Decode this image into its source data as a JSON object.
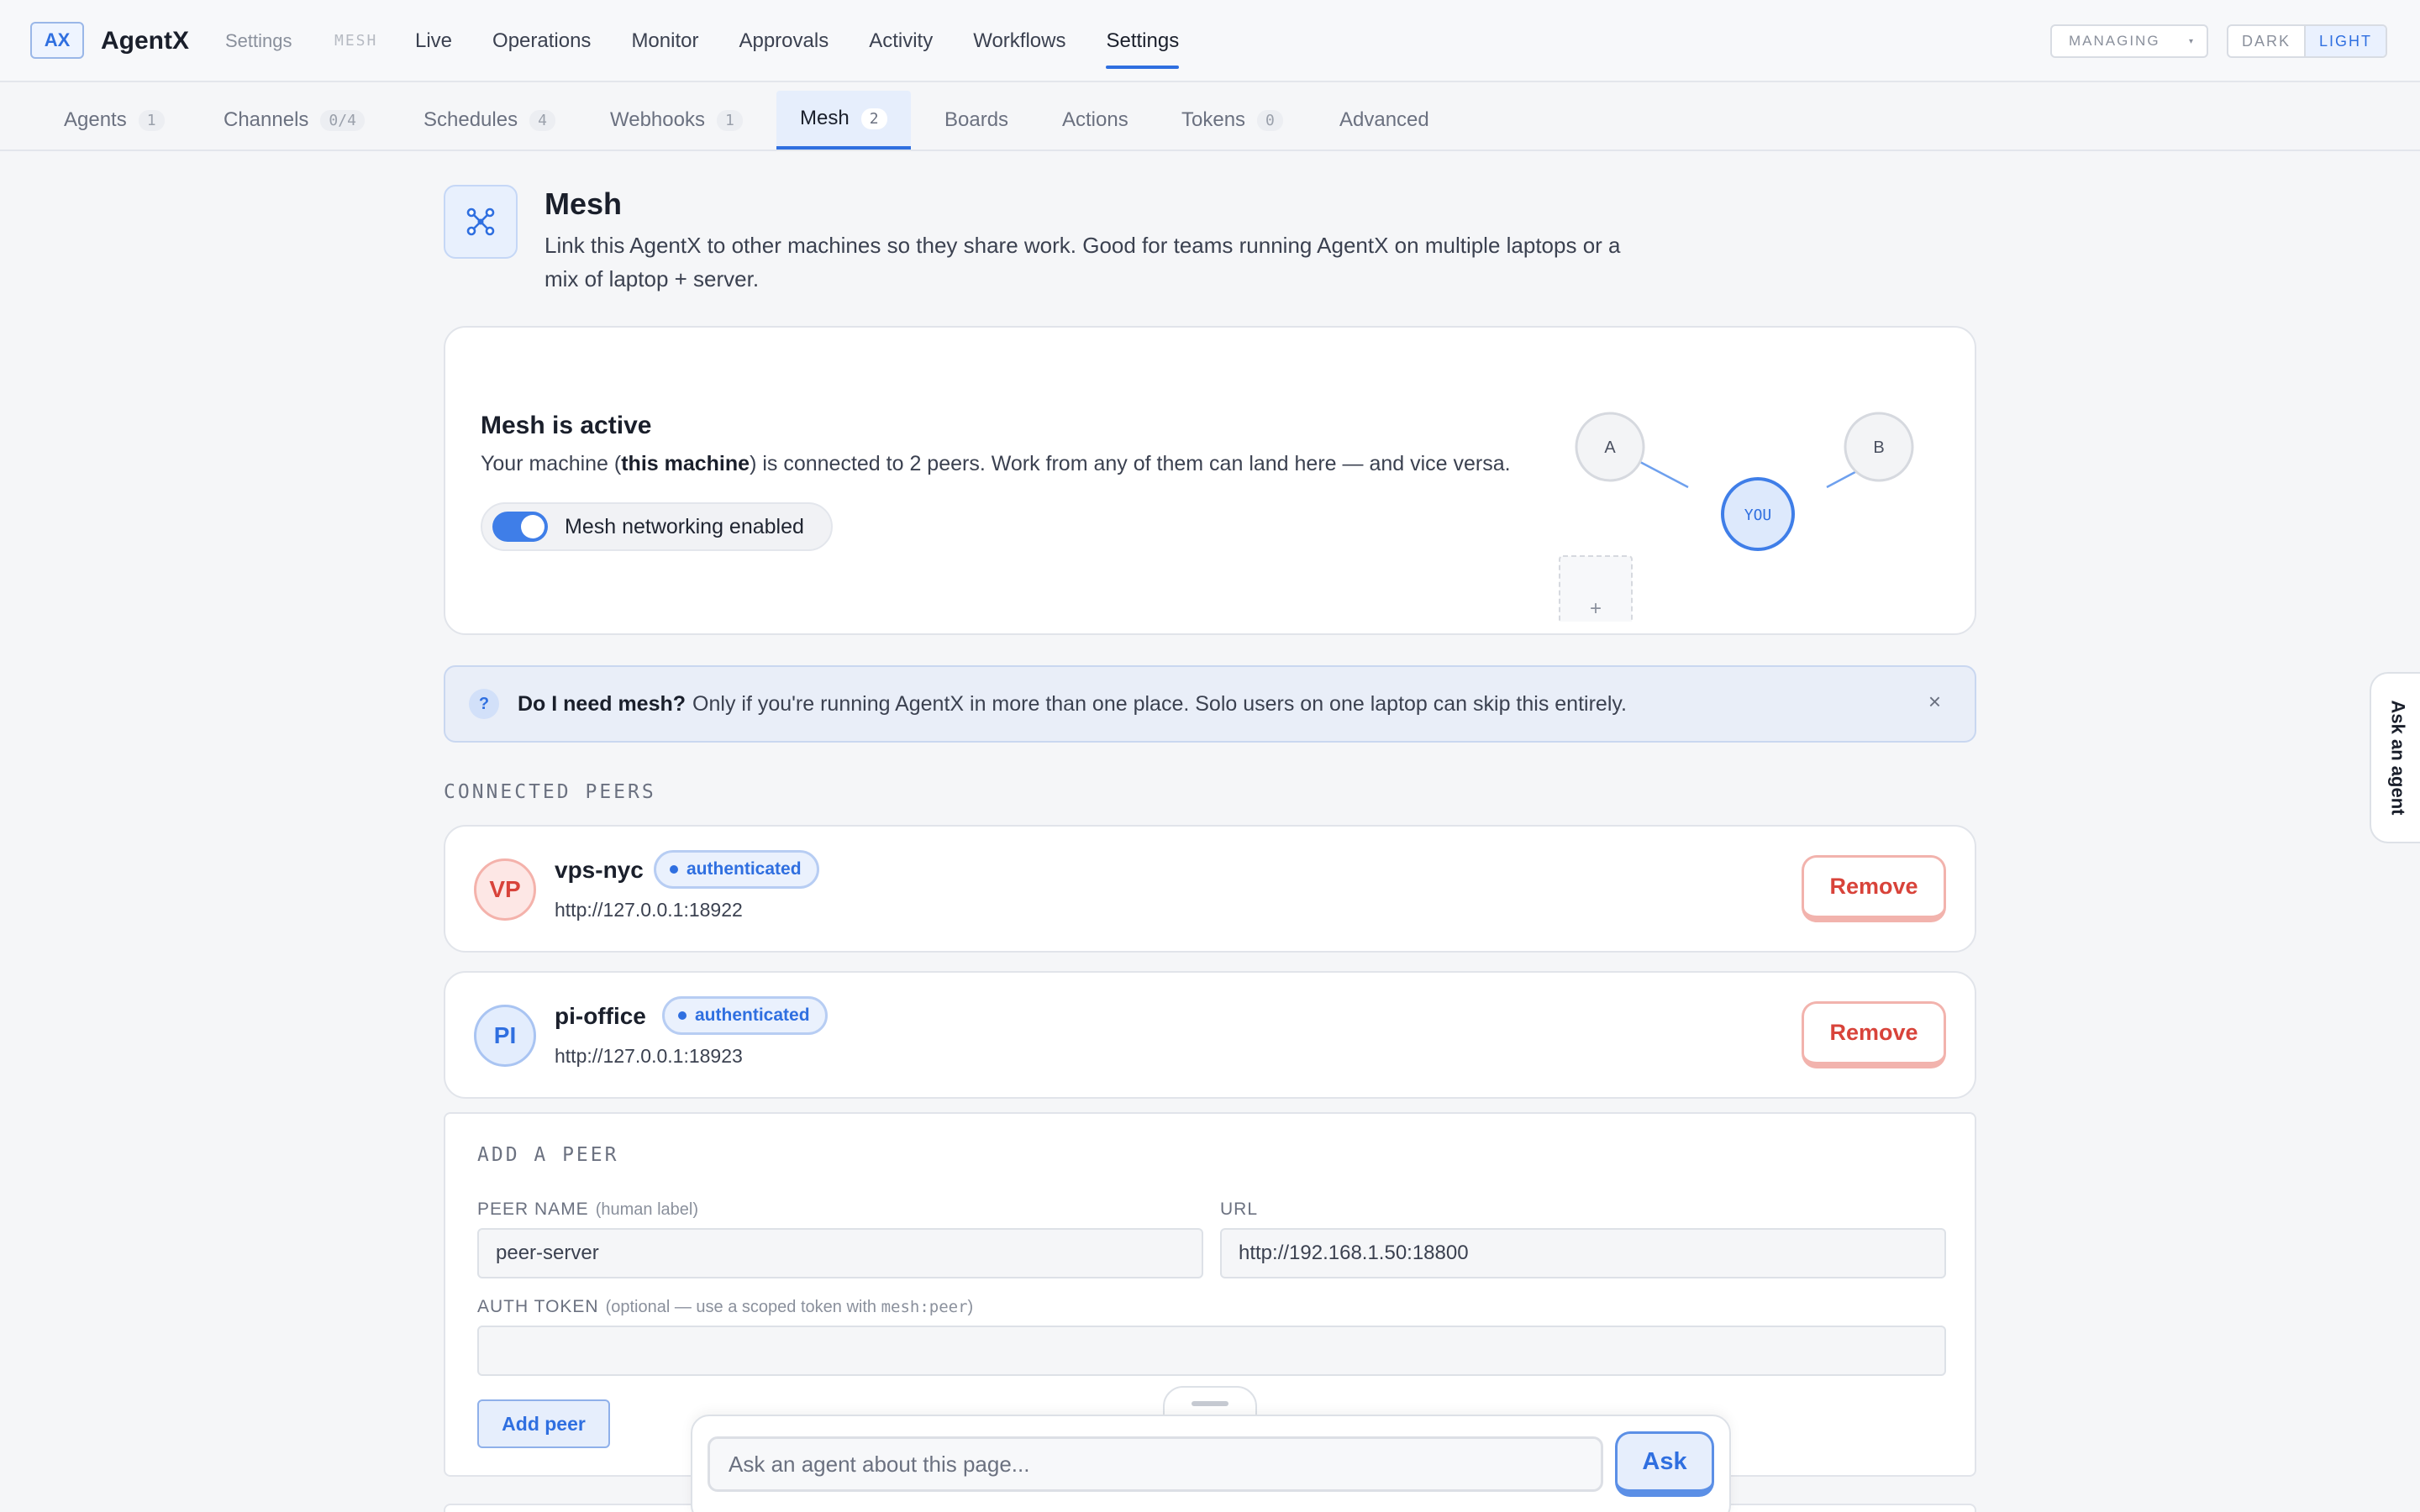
{
  "app": {
    "logo": "AX",
    "name": "AgentX",
    "breadcrumb": "Settings",
    "section_tag": "MESH"
  },
  "topnav": {
    "items": [
      {
        "label": "Live",
        "active": false
      },
      {
        "label": "Operations",
        "active": false
      },
      {
        "label": "Monitor",
        "active": false
      },
      {
        "label": "Approvals",
        "active": false
      },
      {
        "label": "Activity",
        "active": false
      },
      {
        "label": "Workflows",
        "active": false
      },
      {
        "label": "Settings",
        "active": true
      }
    ],
    "managing_label": "MANAGING",
    "theme": {
      "dark": "DARK",
      "light": "LIGHT",
      "selected": "light"
    }
  },
  "subtabs": [
    {
      "label": "Agents",
      "count": "1"
    },
    {
      "label": "Channels",
      "count": "0/4"
    },
    {
      "label": "Schedules",
      "count": "4"
    },
    {
      "label": "Webhooks",
      "count": "1"
    },
    {
      "label": "Mesh",
      "count": "2",
      "active": true
    },
    {
      "label": "Boards",
      "count": ""
    },
    {
      "label": "Actions",
      "count": ""
    },
    {
      "label": "Tokens",
      "count": "0"
    },
    {
      "label": "Advanced",
      "count": ""
    }
  ],
  "header": {
    "icon": "mesh-network-icon",
    "title": "Mesh",
    "description": "Link this AgentX to other machines so they share work. Good for teams running AgentX on multiple laptops or a mix of laptop + server."
  },
  "status": {
    "title": "Mesh is active",
    "text_pre": "Your machine (",
    "text_bold": "this machine",
    "text_post": ") is connected to 2 peers. Work from any of them can land here — and vice versa.",
    "toggle_label": "Mesh networking enabled",
    "toggle_on": true,
    "graph": {
      "nodes": [
        "A",
        "B",
        "YOU"
      ],
      "add_label": "+"
    }
  },
  "info": {
    "badge": "?",
    "question": "Do I need mesh?",
    "answer": "Only if you're running AgentX in more than one place. Solo users on one laptop can skip this entirely.",
    "close": "×"
  },
  "peers_section_label": "CONNECTED PEERS",
  "peers": [
    {
      "initials": "VP",
      "name": "vps-nyc",
      "status": "authenticated",
      "url": "http://127.0.0.1:18922",
      "remove_label": "Remove"
    },
    {
      "initials": "PI",
      "name": "pi-office",
      "status": "authenticated",
      "url": "http://127.0.0.1:18923",
      "remove_label": "Remove"
    }
  ],
  "add_peer": {
    "title": "ADD A PEER",
    "name_label": "PEER NAME",
    "name_hint": "(human label)",
    "name_value": "peer-server",
    "url_label": "URL",
    "url_value": "http://192.168.1.50:18800",
    "token_label": "AUTH TOKEN",
    "token_hint_pre": "(optional — use a scoped token with ",
    "token_hint_code": "mesh:peer",
    "token_hint_post": ")",
    "token_value": "",
    "button": "Add peer"
  },
  "ask": {
    "placeholder": "Ask an agent about this page...",
    "button": "Ask",
    "side_tab": "Ask an agent"
  },
  "colors": {
    "accent": "#2f6fe0",
    "danger": "#d8433a",
    "toggle_on": "#3f7ee8"
  }
}
